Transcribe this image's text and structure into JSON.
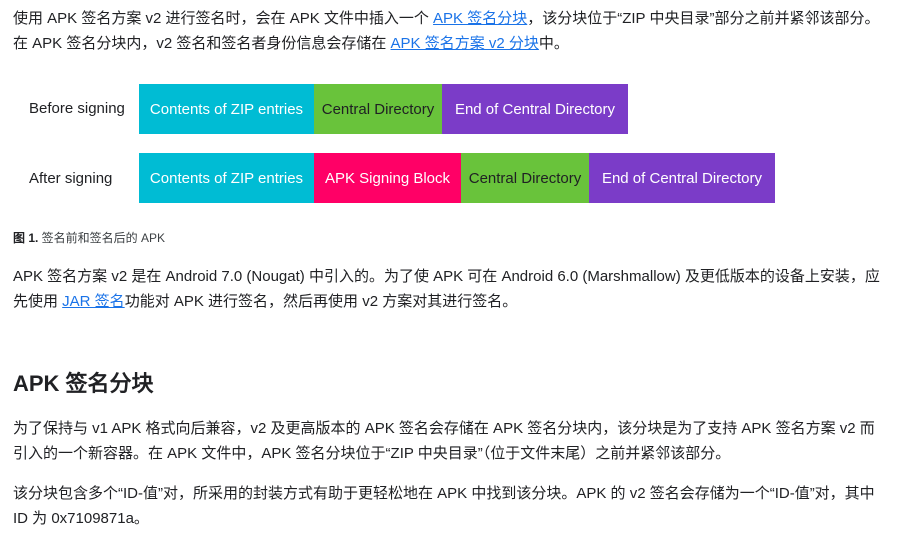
{
  "intro": {
    "part1": "使用 APK 签名方案 v2 进行签名时，会在 APK 文件中插入一个 ",
    "link1": "APK 签名分块",
    "part2": "，该分块位于“ZIP 中央目录”部分之前并紧邻该部分。在 APK 签名分块内，v2 签名和签名者身份信息会存储在 ",
    "link2": "APK 签名方案 v2 分块",
    "part3": "中。"
  },
  "diagram": {
    "before_label": "Before signing",
    "after_label": "After signing",
    "before_blocks": [
      {
        "label": "Contents of ZIP entries",
        "color": "#00bcd4",
        "text_color": "#ffffff"
      },
      {
        "label": "Central Directory",
        "color": "#69c33b",
        "text_color": "#202124"
      },
      {
        "label": "End of Central Directory",
        "color": "#7b3cc8",
        "text_color": "#ffffff"
      }
    ],
    "after_blocks": [
      {
        "label": "Contents of ZIP entries",
        "color": "#00bcd4",
        "text_color": "#ffffff"
      },
      {
        "label": "APK Signing Block",
        "color": "#ff0066",
        "text_color": "#ffffff"
      },
      {
        "label": "Central Directory",
        "color": "#69c33b",
        "text_color": "#202124"
      },
      {
        "label": "End of Central Directory",
        "color": "#7b3cc8",
        "text_color": "#ffffff"
      }
    ]
  },
  "caption": {
    "label": "图 1.",
    "text": " 签名前和签名后的 APK"
  },
  "para2": {
    "part1": "APK 签名方案 v2 是在 Android 7.0 (Nougat) 中引入的。为了使 APK 可在 Android 6.0 (Marshmallow) 及更低版本的设备上安装，应先使用 ",
    "link": "JAR 签名",
    "part2": "功能对 APK 进行签名，然后再使用 v2 方案对其进行签名。"
  },
  "section": {
    "heading": "APK 签名分块",
    "para3": "为了保持与 v1 APK 格式向后兼容，v2 及更高版本的 APK 签名会存储在 APK 签名分块内，该分块是为了支持 APK 签名方案 v2 而引入的一个新容器。在 APK 文件中，APK 签名分块位于“ZIP 中央目录”（位于文件末尾）之前并紧邻该部分。",
    "para4": "该分块包含多个“ID-值”对，所采用的封装方式有助于更轻松地在 APK 中找到该分块。APK 的 v2 签名会存储为一个“ID-值”对，其中 ID 为 0x7109871a。"
  }
}
